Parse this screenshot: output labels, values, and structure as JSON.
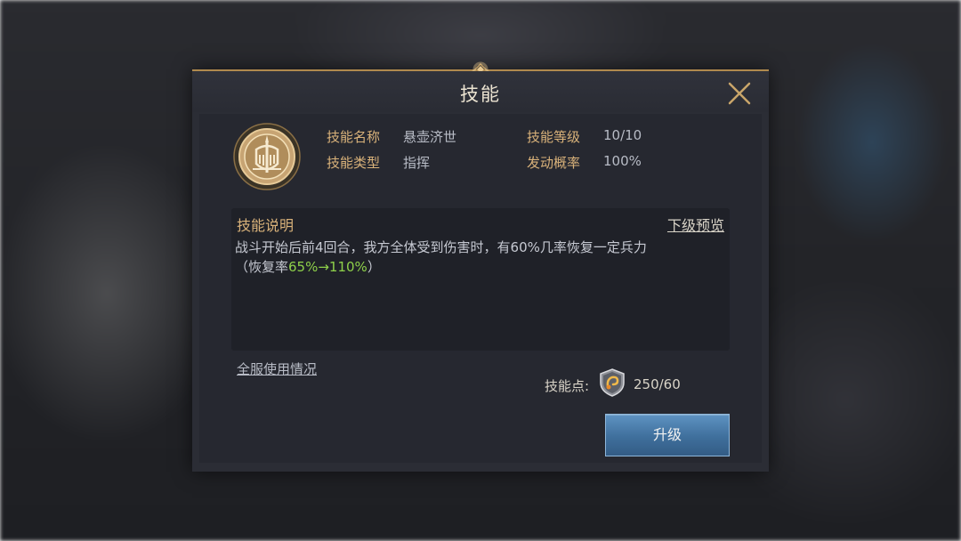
{
  "dialog": {
    "title": "技能",
    "close_icon": "close-x-icon"
  },
  "skill": {
    "icon": "crest-shield-icon",
    "name_label": "技能名称",
    "name_value": "悬壶济世",
    "level_label": "技能等级",
    "level_value": "10/10",
    "type_label": "技能类型",
    "type_value": "指挥",
    "chance_label": "发动概率",
    "chance_value": "100%"
  },
  "description": {
    "title": "技能说明",
    "preview_link": "下级预览",
    "text_main": "战斗开始后前4回合，我方全体受到伤害时，有60%几率恢复一定兵力",
    "text_prefix": "（恢复率",
    "text_green": "65%→110%",
    "text_suffix": "）"
  },
  "usage_link": "全服使用情况",
  "points": {
    "label": "技能点:",
    "icon": "skill-point-badge-icon",
    "value": "250/60"
  },
  "upgrade_button": "升级",
  "colors": {
    "accent_gold": "#d9b27a",
    "highlight_green": "#8ed04a",
    "button_blue": "#3f6f9c"
  }
}
